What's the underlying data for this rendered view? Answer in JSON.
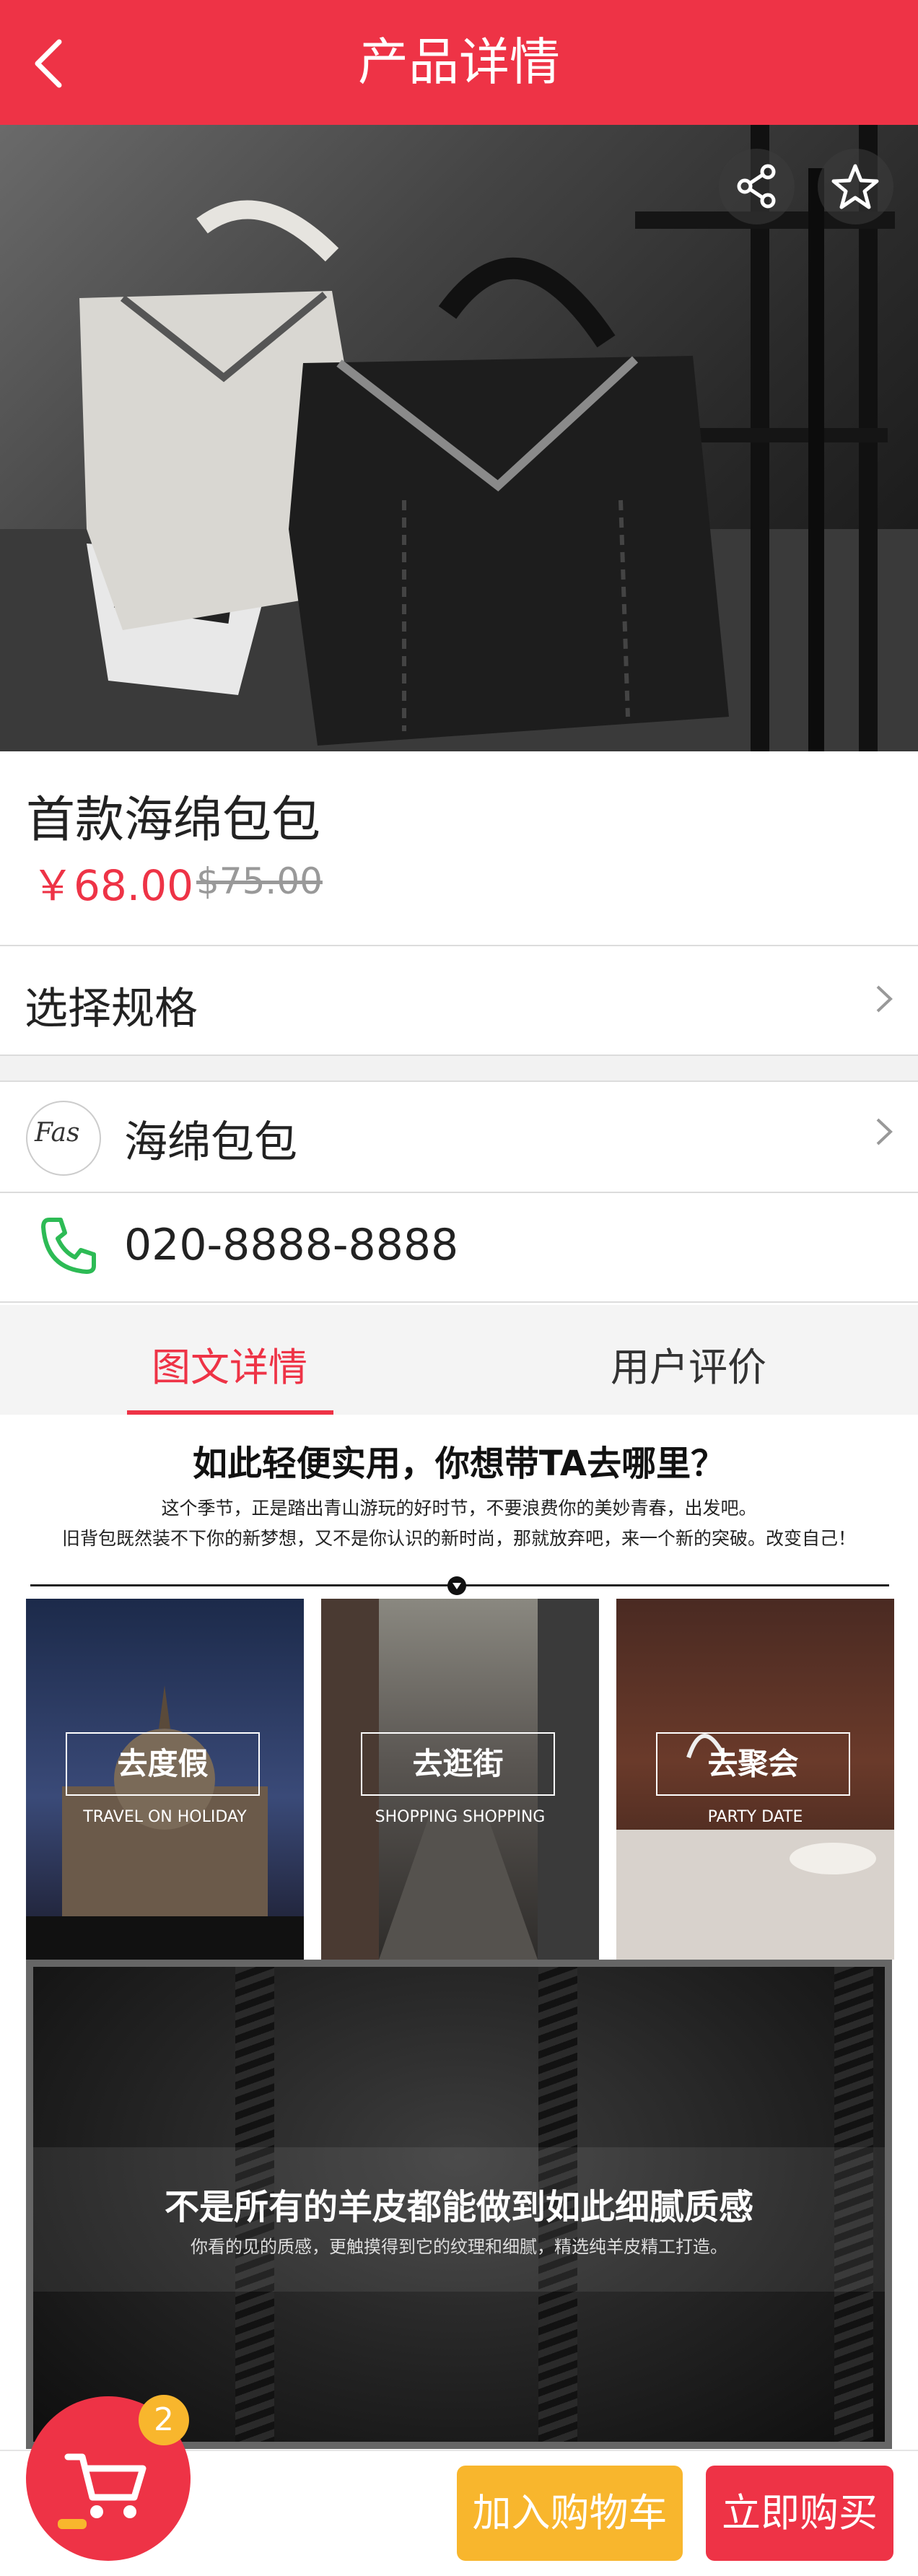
{
  "header": {
    "title": "产品详情"
  },
  "product": {
    "name": "首款海绵包包",
    "price": "￥68.00",
    "original_price": "$75.00"
  },
  "spec_row": {
    "label": "选择规格"
  },
  "shop_row": {
    "name": "海绵包包",
    "avatar_text": "Fas"
  },
  "phone_row": {
    "number": "020-8888-8888"
  },
  "tabs": [
    {
      "label": "图文详情",
      "active": true
    },
    {
      "label": "用户评价",
      "active": false
    }
  ],
  "detail": {
    "heading": "如此轻便实用，你想带TA去哪里？",
    "line1": "这个季节，正是踏出青山游玩的好时节，不要浪费你的美妙青春，出发吧。",
    "line2": "旧背包既然装不下你的新梦想，又不是你认识的新时尚，那就放弃吧，来一个新的突破。改变自己！",
    "scenes": [
      {
        "title": "去度假",
        "subtitle": "TRAVEL ON HOLIDAY"
      },
      {
        "title": "去逛街",
        "subtitle": "SHOPPING SHOPPING"
      },
      {
        "title": "去聚会",
        "subtitle": "PARTY DATE"
      }
    ],
    "leather_title": "不是所有的羊皮都能做到如此细腻质感",
    "leather_sub": "你看的见的质感，更触摸得到它的纹理和细腻，精选纯羊皮精工打造。"
  },
  "cart": {
    "badge": "2"
  },
  "buttons": {
    "add_to_cart": "加入购物车",
    "buy_now": "立即购买"
  },
  "colors": {
    "brand_red": "#ee3346",
    "accent_yellow": "#f8b62d",
    "phone_green": "#2dbb55"
  }
}
